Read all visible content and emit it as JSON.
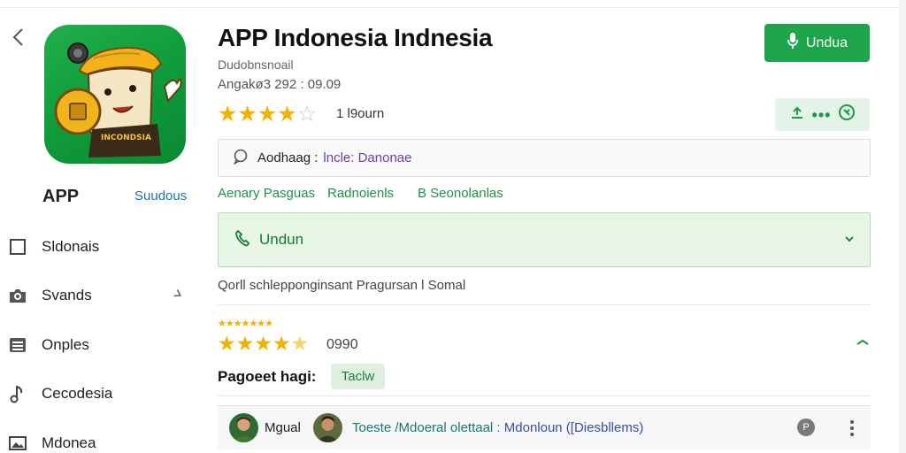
{
  "header": {
    "title": "APP Indonesia Indnesia",
    "developer": "Dudobnsnoail",
    "meta": "Angakø3 292  :  09.09",
    "rating_text": "1 l9ourn",
    "primary_button_label": "Unduа"
  },
  "sidebar": {
    "app_label": "APP",
    "app_link": "Suudous",
    "items": [
      {
        "label": "Sldonais",
        "icon": "square-icon"
      },
      {
        "label": "Svands",
        "icon": "camera-icon"
      },
      {
        "label": "Onples",
        "icon": "archive-icon"
      },
      {
        "label": "Cecodesia",
        "icon": "music-note-icon"
      },
      {
        "label": "Mdonea",
        "icon": "image-icon"
      }
    ]
  },
  "info_bar": {
    "key": "Aodhaag :",
    "value": "lncle: Danonae"
  },
  "tabs": [
    "Aenary Pasguas",
    "Radnoienls",
    "B Seonolanlas"
  ],
  "download_panel": {
    "label": "Undun"
  },
  "description": "Qorll schlepponginsant Pragursan l Somal",
  "reviews": {
    "mini_stars": "★★★★★★★",
    "rating": 4.5,
    "count": "0990",
    "recommend_label": "Pagoeet hagi:",
    "recommend_chip": "Taclw"
  },
  "comment": {
    "user": "Mgual",
    "text_prefix": "Toeste /Mdoeral olettaal :",
    "text_highlight": " Mdonloun ([Diesbllems)"
  },
  "colors": {
    "accent_green": "#1ea54b",
    "star": "#f1b100",
    "purple_value": "#6b3fa8"
  }
}
